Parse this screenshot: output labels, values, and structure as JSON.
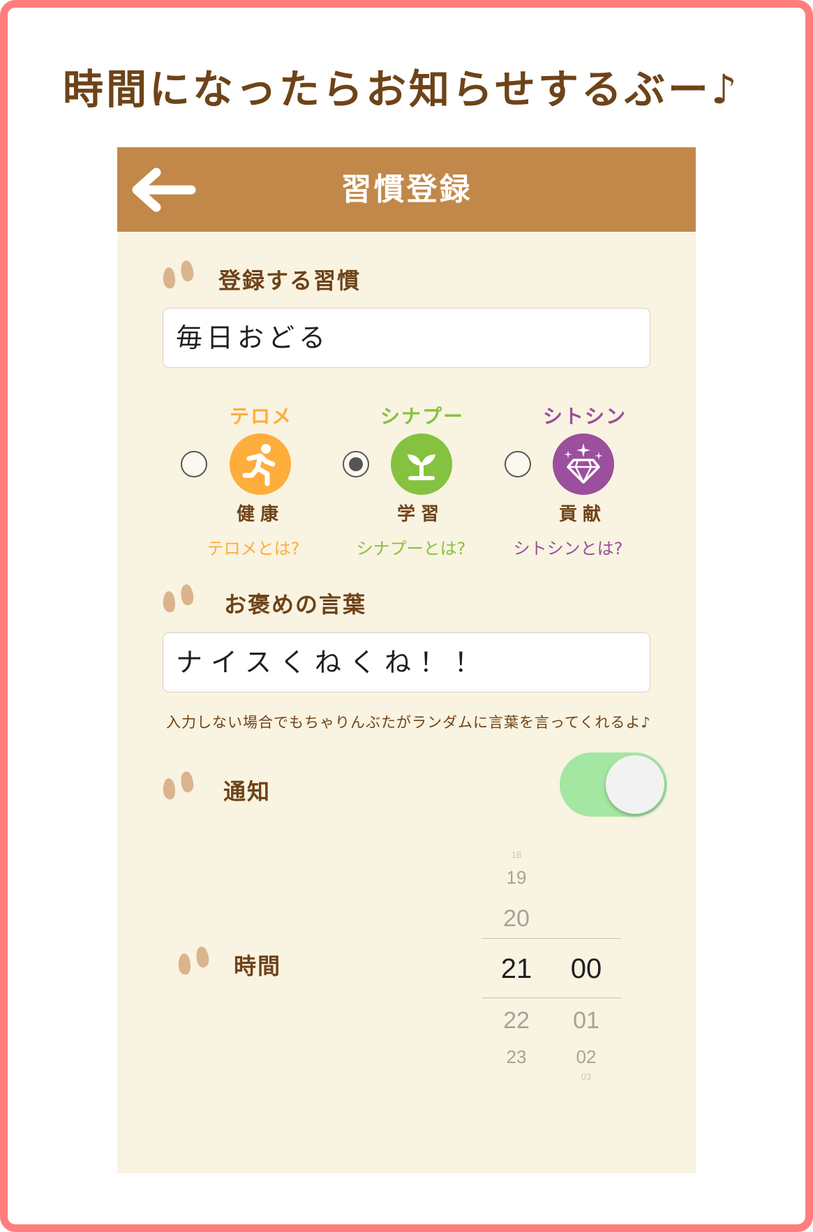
{
  "headline": "時間になったらお知らせするぶー♪",
  "navbar": {
    "title": "習慣登録",
    "back_icon": "arrow-left-icon"
  },
  "habit_section": {
    "label": "登録する習慣",
    "value": "毎日おどる"
  },
  "categories": [
    {
      "name": "テロメ",
      "label": "健康",
      "link": "テロメとは?",
      "color": "#ffad3b",
      "icon": "running-person-icon",
      "selected": false
    },
    {
      "name": "シナプー",
      "label": "学習",
      "link": "シナプーとは?",
      "color": "#85c23f",
      "icon": "sprout-icon",
      "selected": true
    },
    {
      "name": "シトシン",
      "label": "貢献",
      "link": "シトシンとは?",
      "color": "#9b4f9d",
      "icon": "diamond-icon",
      "selected": false
    }
  ],
  "praise_section": {
    "label": "お褒めの言葉",
    "value": "ナイスくねくね！！",
    "hint": "入力しない場合でもちゃりんぶたがランダムに言葉を言ってくれるよ♪"
  },
  "notify_section": {
    "label": "通知",
    "toggle_on": true
  },
  "time_section": {
    "label": "時間",
    "hours": [
      "18",
      "19",
      "20",
      "21",
      "22",
      "23"
    ],
    "minutes": [
      "00",
      "01",
      "02",
      "03"
    ],
    "selected_hour": "21",
    "selected_minute": "00"
  },
  "colors": {
    "frame": "#ff7d7d",
    "navbar": "#c1884a",
    "background": "#f9f3e1",
    "text_brown": "#6e4318",
    "paw": "#dbb48e",
    "toggle": "#a3e7a3"
  }
}
